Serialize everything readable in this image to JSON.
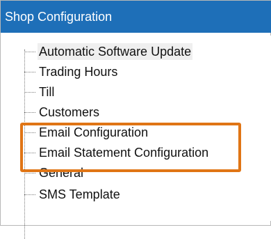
{
  "panel": {
    "title": "Shop Configuration"
  },
  "tree": {
    "items": [
      {
        "label": "Automatic Software Update"
      },
      {
        "label": "Trading Hours"
      },
      {
        "label": "Till"
      },
      {
        "label": "Customers"
      },
      {
        "label": "Email Configuration"
      },
      {
        "label": "Email Statement Configuration"
      },
      {
        "label": "General"
      },
      {
        "label": "SMS Template"
      }
    ],
    "selected_index": 0,
    "highlighted_labels": [
      "Email Configuration",
      "Email Statement Configuration"
    ]
  },
  "colors": {
    "header_bg": "#1e6fb8",
    "header_text": "#ffffff",
    "highlight_border": "#e07515",
    "selected_bg": "#efefef"
  }
}
